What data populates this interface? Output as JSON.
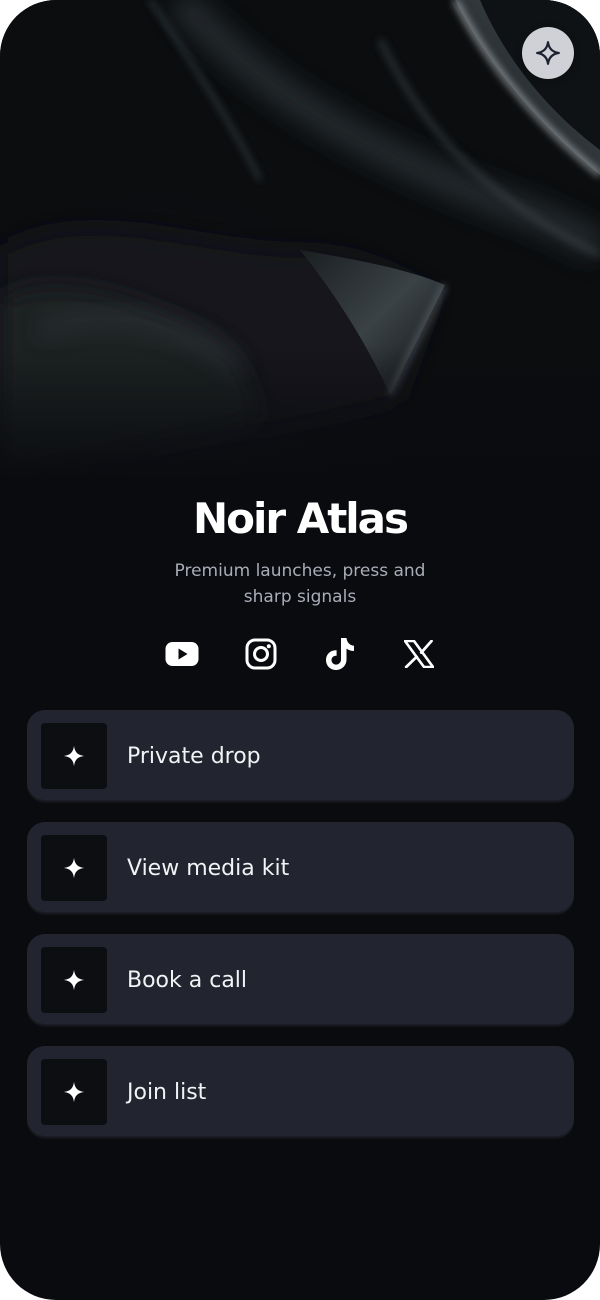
{
  "profile": {
    "name": "Noir Atlas",
    "bio": "Premium launches, press and sharp signals"
  },
  "header": {
    "action_icon": "sparkle-icon"
  },
  "socials": [
    {
      "icon": "youtube-icon"
    },
    {
      "icon": "instagram-icon"
    },
    {
      "icon": "tiktok-icon"
    },
    {
      "icon": "x-icon"
    }
  ],
  "links": [
    {
      "label": "Private drop",
      "icon": "sparkle-icon"
    },
    {
      "label": "View media kit",
      "icon": "sparkle-icon"
    },
    {
      "label": "Book a call",
      "icon": "sparkle-icon"
    },
    {
      "label": "Join list",
      "icon": "sparkle-icon"
    }
  ],
  "colors": {
    "background": "#0a0b0f",
    "card": "#222530",
    "icon_box": "#0d0e12",
    "text": "#ffffff",
    "muted_text": "#a9adb7",
    "fab": "#cfd1d6"
  }
}
